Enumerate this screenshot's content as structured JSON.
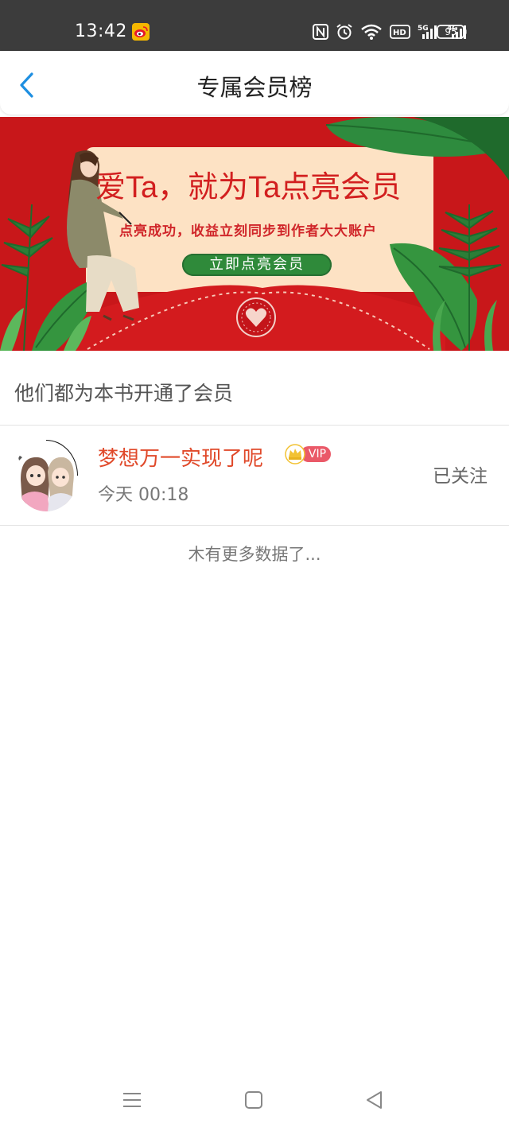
{
  "status_bar": {
    "time": "13:42",
    "battery": "95",
    "icons": [
      "weibo-icon",
      "nfc-icon",
      "alarm-icon",
      "wifi-icon",
      "hd-icon",
      "signal-5g-icon",
      "signal-4g-icon",
      "battery-icon"
    ]
  },
  "nav": {
    "title": "专属会员榜",
    "back_icon": "chevron-left-icon"
  },
  "banner": {
    "headline": "爱Ta，就为Ta点亮会员",
    "subtitle": "点亮成功，收益立刻同步到作者大大账户",
    "cta": "立即点亮会员"
  },
  "section": {
    "title": "他们都为本书开通了会员"
  },
  "members": [
    {
      "name": "梦想万一实现了呢",
      "badge": "VIP",
      "time": "今天 00:18",
      "follow": "已关注"
    }
  ],
  "footer": {
    "no_more": "木有更多数据了..."
  },
  "colors": {
    "accent_blue": "#1e8fe1",
    "banner_red": "#c8171a",
    "name_red": "#e0492a",
    "vip_pink": "#ea5968",
    "cta_green": "#2f8a3a"
  }
}
